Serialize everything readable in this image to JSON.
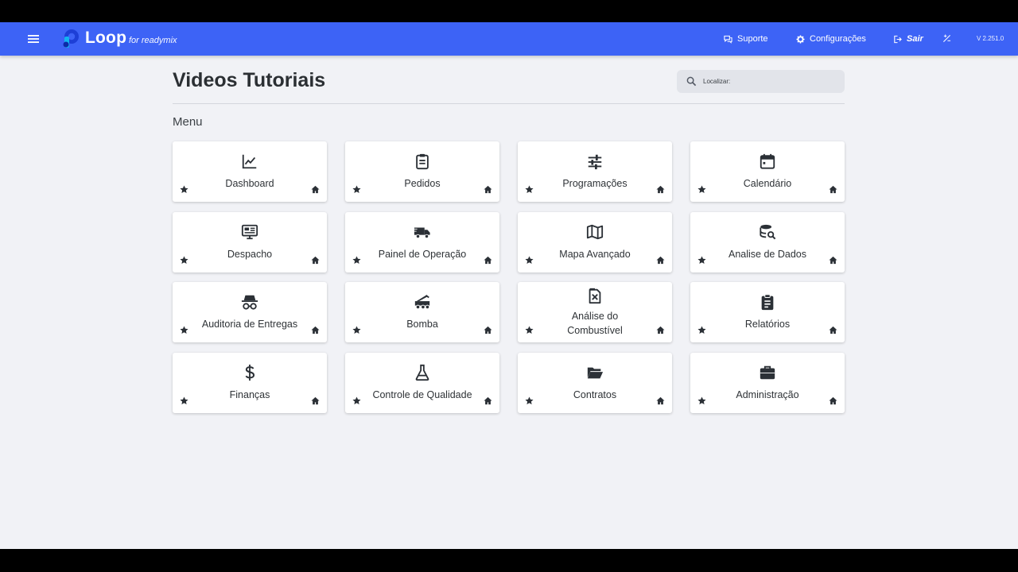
{
  "header": {
    "logo_text": "Loop",
    "logo_subtitle": "for readymix",
    "menu_icon": "hamburger-icon",
    "nav": [
      {
        "label": "Suporte",
        "icon": "chat-icon"
      },
      {
        "label": "Configurações",
        "icon": "gear-icon"
      },
      {
        "label": "Sair",
        "icon": "logout-icon"
      }
    ],
    "theme_icon": "palette-icon",
    "version": "V 2.251.0",
    "accent_color": "#3d63f6"
  },
  "page": {
    "title": "Videos Tutoriais",
    "search_placeholder": "Localizar:",
    "search_value": "",
    "section_title": "Menu"
  },
  "cards": [
    {
      "label": "Dashboard",
      "icon": "chart-line-icon"
    },
    {
      "label": "Pedidos",
      "icon": "clipboard-icon"
    },
    {
      "label": "Programações",
      "icon": "schedule-sliders-icon"
    },
    {
      "label": "Calendário",
      "icon": "calendar-icon"
    },
    {
      "label": "Despacho",
      "icon": "monitor-icon"
    },
    {
      "label": "Painel de Operação",
      "icon": "truck-icon"
    },
    {
      "label": "Mapa Avançado",
      "icon": "map-icon"
    },
    {
      "label": "Analise de Dados",
      "icon": "database-search-icon"
    },
    {
      "label": "Auditoria de Entregas",
      "icon": "spy-icon"
    },
    {
      "label": "Bomba",
      "icon": "pump-truck-icon"
    },
    {
      "label": "Análise do Combustível",
      "icon": "fuel-icon"
    },
    {
      "label": "Relatórios",
      "icon": "report-icon"
    },
    {
      "label": "Finanças",
      "icon": "dollar-icon"
    },
    {
      "label": "Controle de Qualidade",
      "icon": "flask-icon"
    },
    {
      "label": "Contratos",
      "icon": "folder-open-icon"
    },
    {
      "label": "Administração",
      "icon": "briefcase-icon"
    }
  ]
}
